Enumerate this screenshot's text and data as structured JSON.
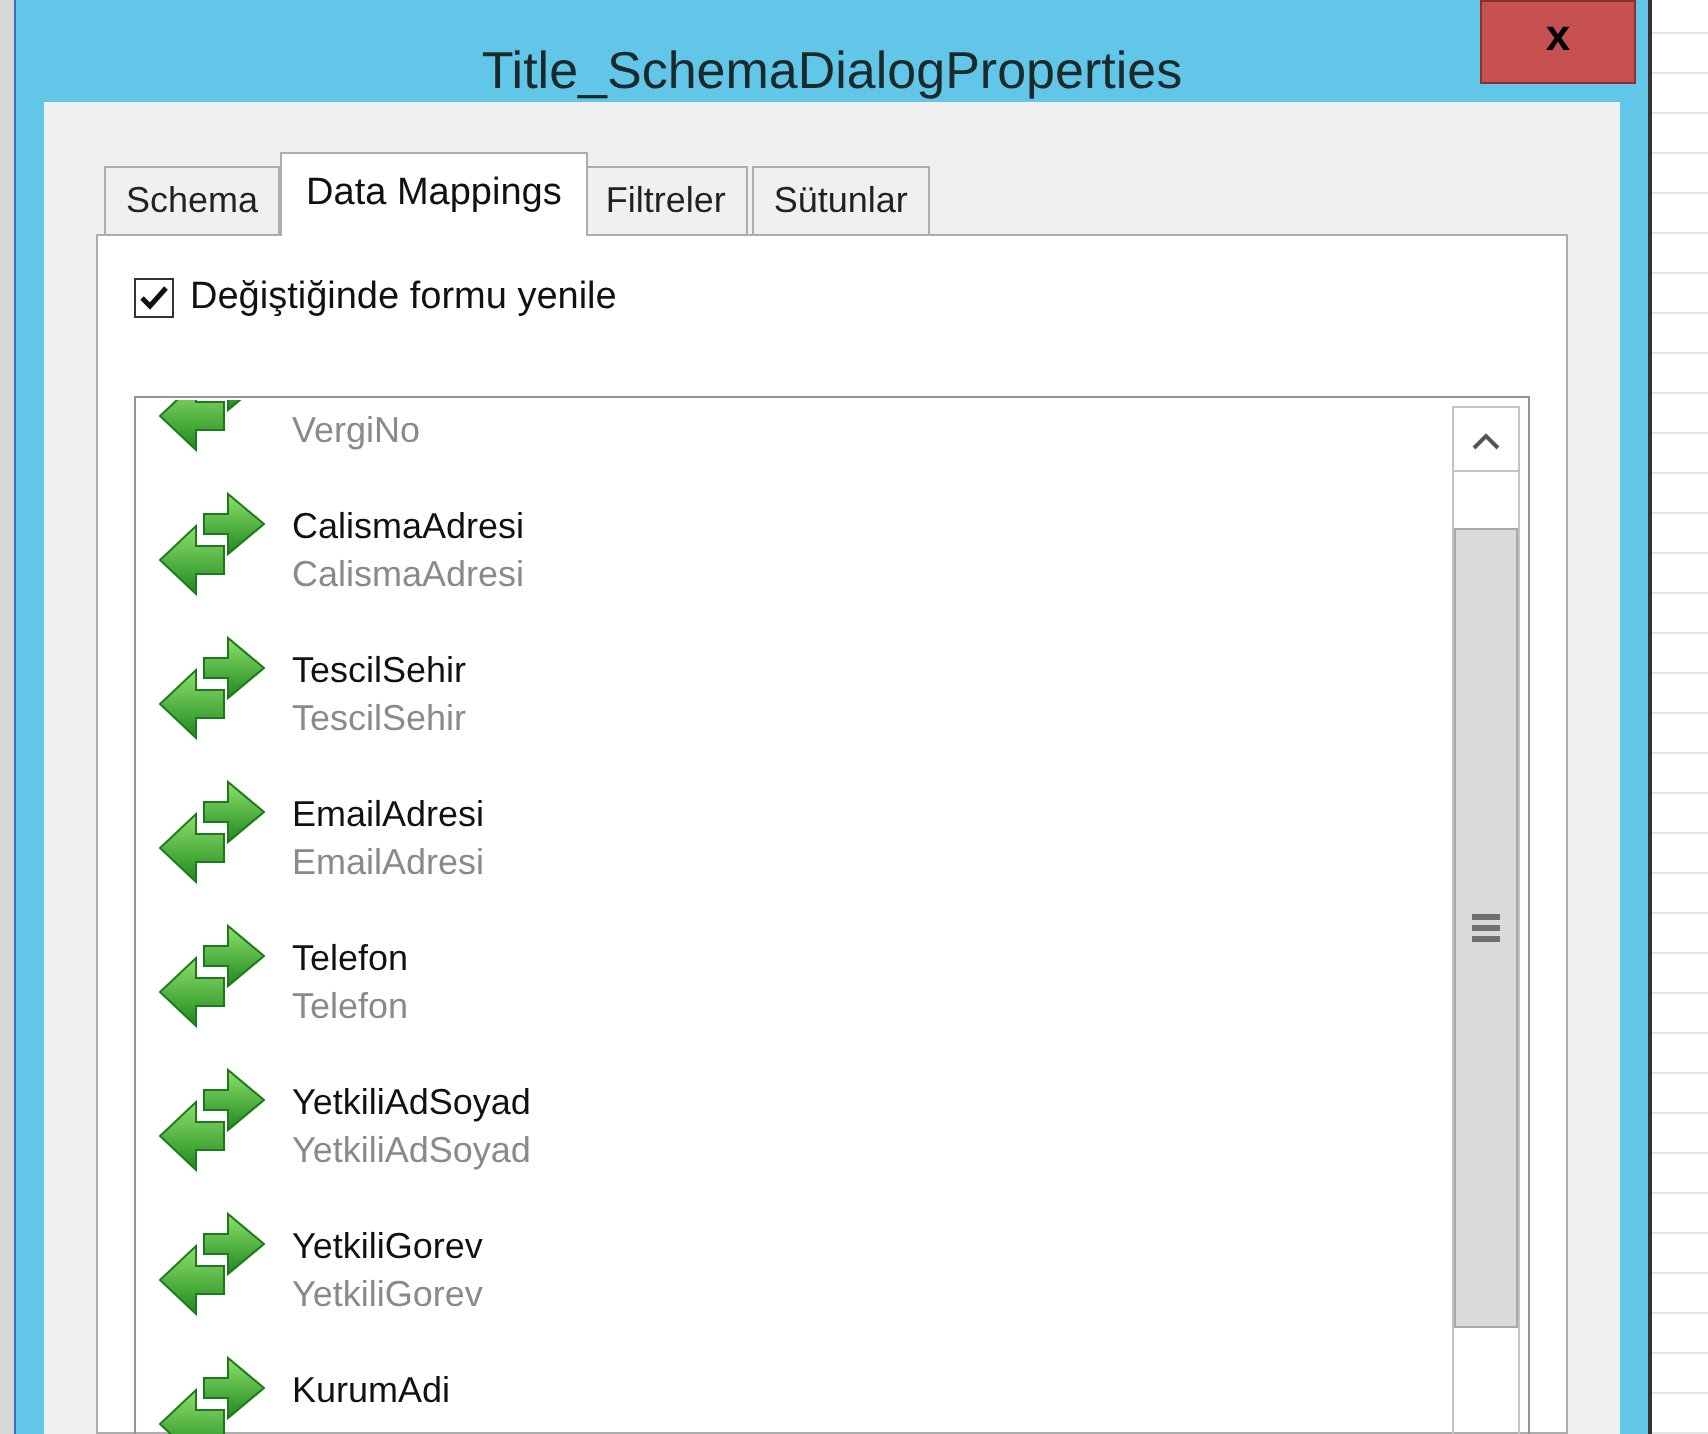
{
  "window": {
    "title": "Title_SchemaDialogProperties",
    "close": "x"
  },
  "tabs": [
    {
      "label": "Schema",
      "selected": false
    },
    {
      "label": "Data Mappings",
      "selected": true
    },
    {
      "label": "Filtreler",
      "selected": false
    },
    {
      "label": "Sütunlar",
      "selected": false
    }
  ],
  "refresh_option": {
    "label": "Değiştiğinde formu yenile",
    "checked": true
  },
  "mappings": [
    {
      "source": "VergiNo"
    },
    {
      "name": "CalismaAdresi",
      "source": "CalismaAdresi"
    },
    {
      "name": "TescilSehir",
      "source": "TescilSehir"
    },
    {
      "name": "EmailAdresi",
      "source": "EmailAdresi"
    },
    {
      "name": "Telefon",
      "source": "Telefon"
    },
    {
      "name": "YetkiliAdSoyad",
      "source": "YetkiliAdSoyad"
    },
    {
      "name": "YetkiliGorev",
      "source": "YetkiliGorev"
    },
    {
      "name": "KurumAdi"
    }
  ]
}
